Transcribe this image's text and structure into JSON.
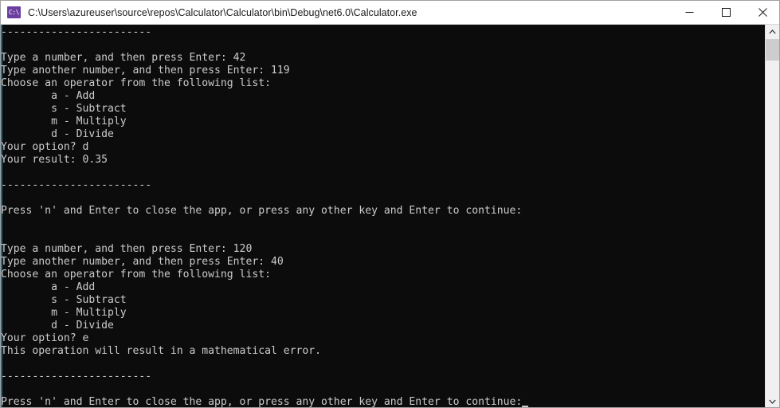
{
  "window": {
    "title": "C:\\Users\\azureuser\\source\\repos\\Calculator\\Calculator\\bin\\Debug\\net6.0\\Calculator.exe",
    "icon_glyph": "C:\\",
    "background_color": "#0c0c0c",
    "text_color": "#cccccc",
    "titlebar_color": "#ffffff",
    "accent_color": "#1d6e8e"
  },
  "controls": {
    "minimize_label": "Minimize",
    "maximize_label": "Maximize",
    "close_label": "Close"
  },
  "scrollbar": {
    "up_arrow": "˄",
    "down_arrow": "˅"
  },
  "console": {
    "lines": [
      "------------------------",
      "",
      "Type a number, and then press Enter: 42",
      "Type another number, and then press Enter: 119",
      "Choose an operator from the following list:",
      "        a - Add",
      "        s - Subtract",
      "        m - Multiply",
      "        d - Divide",
      "Your option? d",
      "Your result: 0.35",
      "",
      "------------------------",
      "",
      "Press 'n' and Enter to close the app, or press any other key and Enter to continue:",
      "",
      "",
      "Type a number, and then press Enter: 120",
      "Type another number, and then press Enter: 40",
      "Choose an operator from the following list:",
      "        a - Add",
      "        s - Subtract",
      "        m - Multiply",
      "        d - Divide",
      "Your option? e",
      "This operation will result in a mathematical error.",
      "",
      "------------------------",
      "",
      "Press 'n' and Enter to close the app, or press any other key and Enter to continue:"
    ],
    "cursor_line_index": 29,
    "cursor_glyph": "_"
  }
}
